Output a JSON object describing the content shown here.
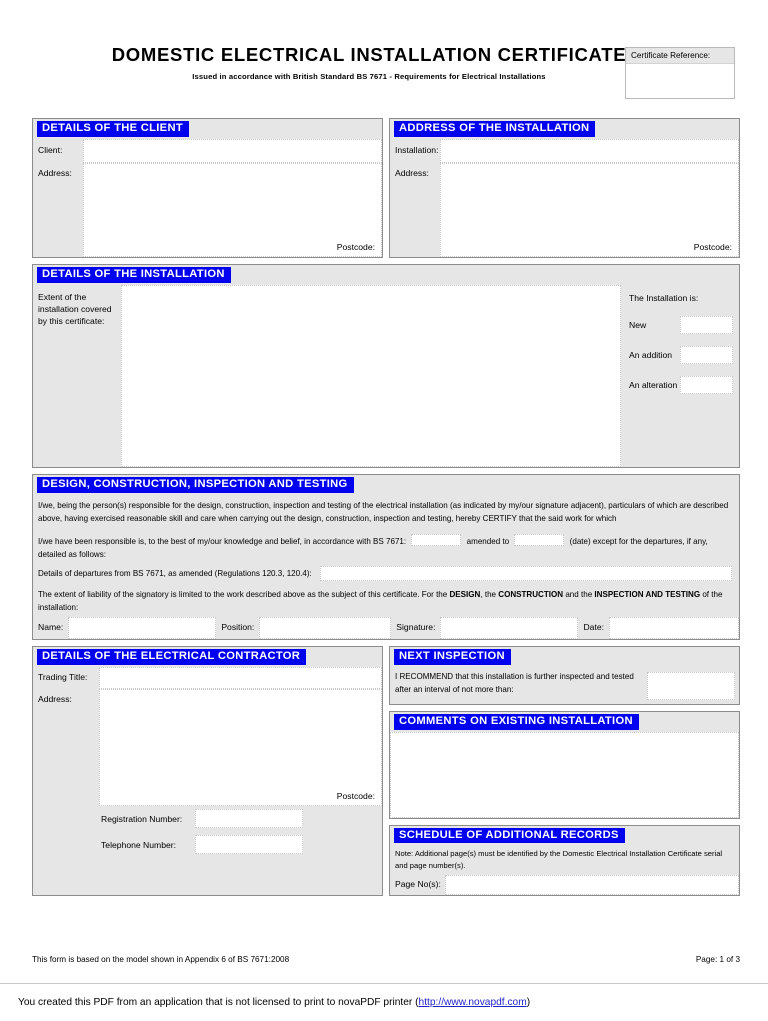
{
  "header": {
    "title": "DOMESTIC ELECTRICAL INSTALLATION CERTIFICATE",
    "subtitle": "Issued in accordance with British Standard BS 7671 - Requirements for Electrical Installations",
    "certificate_reference_label": "Certificate Reference:",
    "certificate_reference_value": ""
  },
  "client": {
    "heading": "DETAILS OF THE CLIENT",
    "client_label": "Client:",
    "client_value": "",
    "address_label": "Address:",
    "address_value": "",
    "postcode_label": "Postcode:",
    "postcode_value": ""
  },
  "installation_address": {
    "heading": "ADDRESS OF THE INSTALLATION",
    "installation_label": "Installation:",
    "installation_value": "",
    "address_label": "Address:",
    "address_value": "",
    "postcode_label": "Postcode:",
    "postcode_value": ""
  },
  "installation_details": {
    "heading": "DETAILS OF THE INSTALLATION",
    "extent_label": "Extent of the installation covered by this certificate:",
    "extent_value": "",
    "type_title": "The Installation is:",
    "options": [
      {
        "label": "New",
        "value": ""
      },
      {
        "label": "An addition",
        "value": ""
      },
      {
        "label": "An alteration",
        "value": ""
      }
    ]
  },
  "design": {
    "heading": "DESIGN, CONSTRUCTION, INSPECTION AND TESTING",
    "paragraph1": "I/we, being the person(s) responsible for the design, construction, inspection and testing of the electrical installation (as indicated by my/our signature adjacent), particulars of which are described above, having exercised reasonable skill and care when carrying out the design, construction, inspection and testing, hereby CERTIFY that the said work for which",
    "para2_part1": "I/we have been responsible is, to the best of my/our knowledge and belief, in accordance with BS 7671:",
    "para2_bs_value": "",
    "para2_part2": "amended to",
    "para2_date_value": "",
    "para2_part3": "(date) except for the departures, if any, detailed as follows:",
    "departures_label": "Details of departures from BS 7671, as amended (Regulations 120.3, 120.4):",
    "departures_value": "",
    "liability_part1": "The extent of liability of the signatory is limited to the work described above as the subject of this certificate. For the ",
    "liability_bold1": "DESIGN",
    "liability_part2": ", the ",
    "liability_bold2": "CONSTRUCTION",
    "liability_part3": " and the ",
    "liability_bold3": "INSPECTION AND TESTING",
    "liability_part4": " of the installation:",
    "name_label": "Name:",
    "name_value": "",
    "position_label": "Position:",
    "position_value": "",
    "signature_label": "Signature:",
    "signature_value": "",
    "date_label": "Date:",
    "date_value": ""
  },
  "contractor": {
    "heading": "DETAILS OF THE ELECTRICAL CONTRACTOR",
    "trading_title_label": "Trading Title:",
    "trading_title_value": "",
    "address_label": "Address:",
    "address_value": "",
    "postcode_label": "Postcode:",
    "postcode_value": "",
    "registration_number_label": "Registration Number:",
    "registration_number_value": "",
    "telephone_number_label": "Telephone Number:",
    "telephone_number_value": ""
  },
  "next_inspection": {
    "heading": "NEXT INSPECTION",
    "text": "I RECOMMEND that this installation is further inspected and tested after an interval of not more than:",
    "interval_value": ""
  },
  "comments": {
    "heading": "COMMENTS ON EXISTING INSTALLATION",
    "value": ""
  },
  "schedule": {
    "heading": "SCHEDULE OF ADDITIONAL RECORDS",
    "note": "Note: Additional page(s) must be identified by the Domestic Electrical Installation Certificate serial and page number(s).",
    "page_nos_label": "Page No(s):",
    "page_nos_value": ""
  },
  "footer": {
    "left": "This form is based on the model shown in Appendix 6 of BS 7671:2008",
    "right": "Page: 1 of 3",
    "nova_prefix": "You created this PDF from an application that is not licensed to print to novaPDF printer (",
    "nova_link": "http://www.novapdf.com",
    "nova_suffix": ")"
  },
  "colors": {
    "band_blue": "#0000f0",
    "panel_gray": "#e6e6e6",
    "border_gray": "#8c8c8c",
    "link_blue": "#2222cc"
  }
}
